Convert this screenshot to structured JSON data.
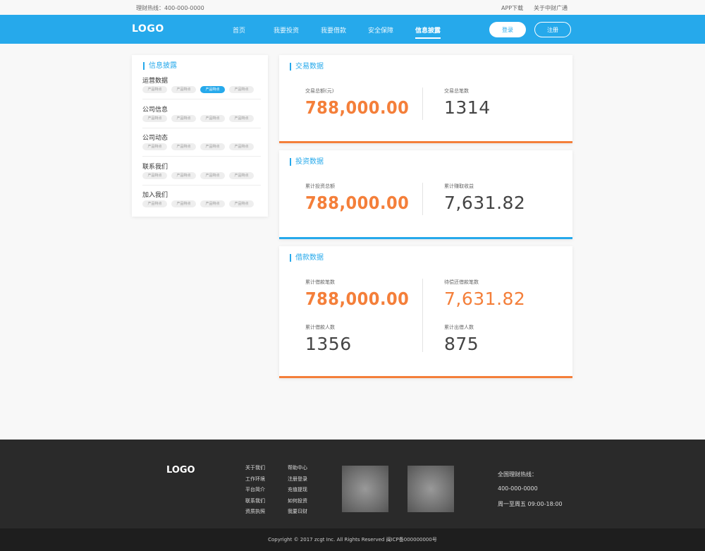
{
  "topbar": {
    "hotline": "理财热线：400-000-0000",
    "app_download": "APP下载",
    "about": "关于中财广通"
  },
  "nav": {
    "logo": "LOGO",
    "items": [
      "首页",
      "我要投资",
      "我要借款",
      "安全保障",
      "信息披露"
    ],
    "active_index": 4,
    "login": "登录",
    "register": "注册"
  },
  "sidebar": {
    "title": "信息披露",
    "groups": [
      {
        "title": "运营数据",
        "tags": [
          "产品特点",
          "产品特点",
          "产品特点",
          "产品特点"
        ],
        "active_tag": 2
      },
      {
        "title": "公司信息",
        "tags": [
          "产品特点",
          "产品特点",
          "产品特点",
          "产品特点"
        ]
      },
      {
        "title": "公司动态",
        "tags": [
          "产品特点",
          "产品特点",
          "产品特点",
          "产品特点"
        ]
      },
      {
        "title": "联系我们",
        "tags": [
          "产品特点",
          "产品特点",
          "产品特点",
          "产品特点"
        ]
      },
      {
        "title": "加入我们",
        "tags": [
          "产品特点",
          "产品特点",
          "产品特点",
          "产品特点"
        ]
      }
    ]
  },
  "cards": {
    "trade": {
      "title": "交易数据",
      "stats": [
        {
          "label": "交易总额(元)",
          "value": "788,000.00"
        },
        {
          "label": "交易总笔数",
          "value": "1314"
        }
      ]
    },
    "invest": {
      "title": "投资数据",
      "stats": [
        {
          "label": "累计投资总额",
          "value": "788,000.00"
        },
        {
          "label": "累计赚取收益",
          "value": "7,631.82"
        }
      ]
    },
    "loan": {
      "title": "借款数据",
      "stats": [
        {
          "label": "累计借款笔数",
          "value": "788,000.00"
        },
        {
          "label": "待偿还借款笔数",
          "value": "7,631.82"
        },
        {
          "label": "累计借款人数",
          "value": "1356"
        },
        {
          "label": "累计出借人数",
          "value": "875"
        }
      ]
    }
  },
  "footer": {
    "logo": "LOGO",
    "links_col1": [
      "关于我们",
      "工作环境",
      "平台简介",
      "联系我们",
      "资质执照"
    ],
    "links_col2": [
      "帮助中心",
      "注册登录",
      "充值提现",
      "如何投资",
      "我要ㄖ财"
    ],
    "hotline_label": "全国理财热线：",
    "hotline_number": "400-000-0000",
    "hours": "周一至周五 09:00-18:00",
    "copyright": "Copyright © 2017 zcgt Inc. All Rights Reserved 闽ICP备000000000号"
  },
  "colors": {
    "primary": "#26a9eb",
    "accent": "#f47f3a",
    "footer_bg": "#2a2a2a"
  }
}
